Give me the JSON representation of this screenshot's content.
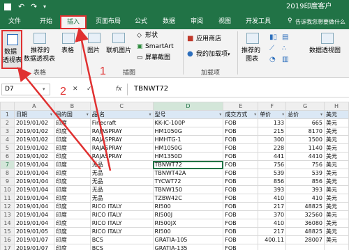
{
  "window": {
    "title": "2019印度客户",
    "undo_icon": "undo-icon",
    "redo_icon": "redo-icon",
    "save_icon": "save-icon"
  },
  "tabs": [
    {
      "label": "文件"
    },
    {
      "label": "开始"
    },
    {
      "label": "插入"
    },
    {
      "label": "页面布局"
    },
    {
      "label": "公式"
    },
    {
      "label": "数据"
    },
    {
      "label": "审阅"
    },
    {
      "label": "视图"
    },
    {
      "label": "开发工具"
    }
  ],
  "tell_me": "告诉我您想要做什么",
  "ribbon": {
    "pivot_label_1": "数据",
    "pivot_label_2": "透视表",
    "recommended_pivot_1": "推荐的",
    "recommended_pivot_2": "数据透视表",
    "table_label": "表格",
    "group_tables": "表格",
    "picture_label": "图片",
    "online_picture_label": "联机图片",
    "shapes_label": "形状",
    "smartart_label": "SmartArt",
    "screenshot_label": "屏幕截图",
    "group_illustrations": "插图",
    "store_label": "应用商店",
    "my_addins_label": "我的加载项",
    "group_addins": "加载项",
    "recommended_charts_1": "推荐的",
    "recommended_charts_2": "图表",
    "pivot_chart_label": "数据透视图"
  },
  "formula_bar": {
    "name_box": "D7",
    "fx": "fx",
    "content": "TBNWT72",
    "cancel": "✕",
    "enter": "✓"
  },
  "annotations": {
    "step1": "1",
    "step2": "2"
  },
  "grid": {
    "columns": [
      "A",
      "B",
      "C",
      "D",
      "E",
      "F",
      "G",
      "H"
    ],
    "header_row": [
      "日期",
      "目的国",
      "品 名",
      "型号",
      "成交方式",
      "单价",
      "总价",
      "美元"
    ],
    "rows": [
      [
        "2019/01/02",
        "印度",
        "Finecraft",
        "KK-IC-100P",
        "FOB",
        "133",
        "665",
        "美元"
      ],
      [
        "2019/01/02",
        "印度",
        "RAJASPRAY",
        "HM1050G",
        "FOB",
        "215",
        "8170",
        "美元"
      ],
      [
        "2019/01/02",
        "印度",
        "RAJASPRAY",
        "HMHTG-1",
        "FOB",
        "300",
        "1500",
        "美元"
      ],
      [
        "2019/01/02",
        "印度",
        "RAJASPRAY",
        "HM1050G",
        "FOB",
        "228",
        "1140",
        "美元"
      ],
      [
        "2019/01/02",
        "印度",
        "RAJASPRAY",
        "HM1350D",
        "FOB",
        "441",
        "4410",
        "美元"
      ],
      [
        "2019/01/04",
        "印度",
        "无品",
        "TBNWT72",
        "FOB",
        "756",
        "756",
        "美元"
      ],
      [
        "2019/01/04",
        "印度",
        "无品",
        "TBNWT42A",
        "FOB",
        "539",
        "539",
        "美元"
      ],
      [
        "2019/01/04",
        "印度",
        "无品",
        "TYCWT72",
        "FOB",
        "856",
        "856",
        "美元"
      ],
      [
        "2019/01/04",
        "印度",
        "无品",
        "TBNW150",
        "FOB",
        "393",
        "393",
        "美元"
      ],
      [
        "2019/01/04",
        "印度",
        "无品",
        "TZBW42C",
        "FOB",
        "410",
        "410",
        "美元"
      ],
      [
        "2019/01/04",
        "印度",
        "RICO ITALY",
        "RI500",
        "FOB",
        "217",
        "48825",
        "美元"
      ],
      [
        "2019/01/04",
        "印度",
        "RICO ITALY",
        "RI500J",
        "FOB",
        "370",
        "32560",
        "美元"
      ],
      [
        "2019/01/04",
        "印度",
        "RICO ITALY",
        "RI500JX",
        "FOB",
        "410",
        "36080",
        "美元"
      ],
      [
        "2019/01/05",
        "印度",
        "RICO ITALY",
        "RI500",
        "FOB",
        "217",
        "48825",
        "美元"
      ],
      [
        "2019/01/07",
        "印度",
        "BCS",
        "GRATIA-105",
        "FOB",
        "400.11",
        "28007",
        "美元"
      ],
      [
        "2019/01/07",
        "印度",
        "BCS",
        "GRATIA-135",
        "FOB",
        "",
        "",
        ""
      ]
    ]
  }
}
